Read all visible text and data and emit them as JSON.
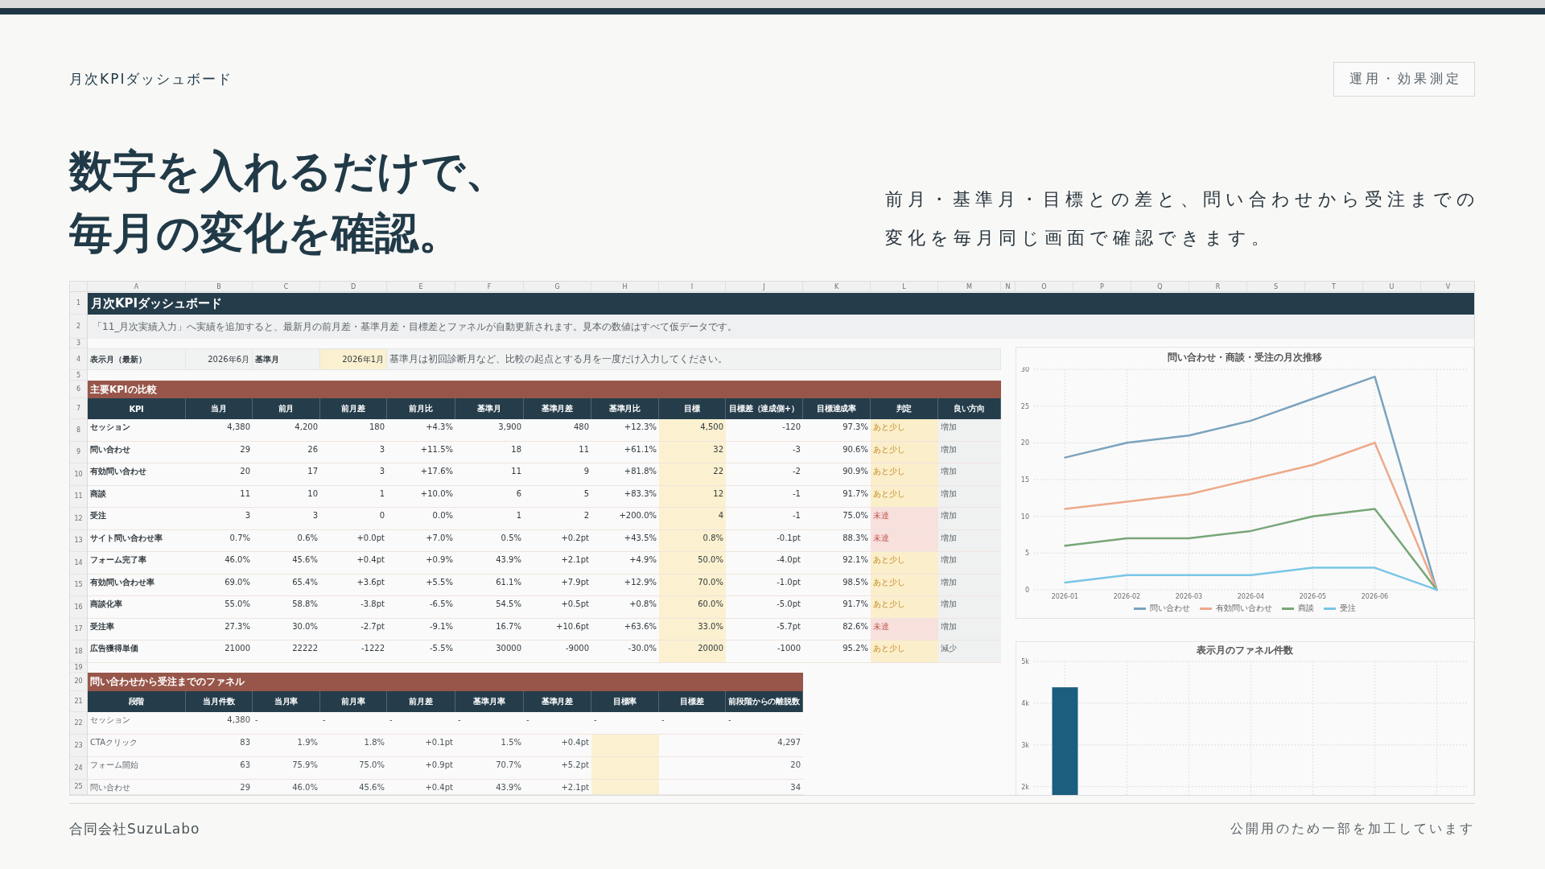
{
  "top": {
    "page_label": "月次KPIダッシュボード",
    "tag": "運用・効果測定"
  },
  "headline": [
    "数字を入れるだけで、",
    "毎月の変化を確認。"
  ],
  "description": [
    "前月・基準月・目標との差と、問い合わせから受注までの",
    "変化を毎月同じ画面で確認できます。"
  ],
  "spreadsheet": {
    "column_letters": [
      "A",
      "B",
      "C",
      "D",
      "E",
      "F",
      "G",
      "H",
      "I",
      "J",
      "K",
      "L",
      "M",
      "N",
      "O",
      "P",
      "Q",
      "R",
      "S",
      "T",
      "U",
      "V"
    ],
    "row_numbers": [
      "1",
      "2",
      "3",
      "4",
      "5",
      "6",
      "7",
      "8",
      "9",
      "10",
      "11",
      "12",
      "13",
      "14",
      "15",
      "16",
      "17",
      "18",
      "19",
      "20",
      "21",
      "22",
      "23",
      "24",
      "25"
    ],
    "title": "月次KPIダッシュボード",
    "note": "「11_月次実績入力」へ実績を追加すると、最新月の前月差・基準月差・目標差とファネルが自動更新されます。見本の数値はすべて仮データです。",
    "month_settings": {
      "fields": [
        {
          "label": "表示月（最新）",
          "value": "2026年6月",
          "input": false
        },
        {
          "label": "基準月",
          "value": "2026年1月",
          "input": true
        }
      ],
      "hint": "基準月は初回診断月など、比較の起点とする月を一度だけ入力してください。"
    },
    "kpi": {
      "title": "主要KPIの比較",
      "columns": [
        {
          "label": "KPI",
          "input": false
        },
        {
          "label": "当月",
          "input": false
        },
        {
          "label": "前月",
          "input": false
        },
        {
          "label": "前月差",
          "input": false
        },
        {
          "label": "前月比",
          "input": false
        },
        {
          "label": "基準月",
          "input": false
        },
        {
          "label": "基準月差",
          "input": false
        },
        {
          "label": "基準月比",
          "input": false
        },
        {
          "label": "目標",
          "input": true
        },
        {
          "label": "目標差（達成側+）",
          "input": false
        },
        {
          "label": "目標達成率",
          "input": false
        },
        {
          "label": "判定",
          "input": false
        },
        {
          "label": "良い方向",
          "input": false
        }
      ],
      "rows": [
        {
          "kpi": "セッション",
          "values": [
            "4,380",
            "4,200",
            "180",
            "+4.3%",
            "3,900",
            "480",
            "+12.3%",
            "4,500",
            "-120",
            "97.3%"
          ],
          "verdict": {
            "text": "あと少し",
            "kind": "near"
          },
          "direction": "増加"
        },
        {
          "kpi": "問い合わせ",
          "values": [
            "29",
            "26",
            "3",
            "+11.5%",
            "18",
            "11",
            "+61.1%",
            "32",
            "-3",
            "90.6%"
          ],
          "verdict": {
            "text": "あと少し",
            "kind": "near"
          },
          "direction": "増加"
        },
        {
          "kpi": "有効問い合わせ",
          "values": [
            "20",
            "17",
            "3",
            "+17.6%",
            "11",
            "9",
            "+81.8%",
            "22",
            "-2",
            "90.9%"
          ],
          "verdict": {
            "text": "あと少し",
            "kind": "near"
          },
          "direction": "増加"
        },
        {
          "kpi": "商談",
          "values": [
            "11",
            "10",
            "1",
            "+10.0%",
            "6",
            "5",
            "+83.3%",
            "12",
            "-1",
            "91.7%"
          ],
          "verdict": {
            "text": "あと少し",
            "kind": "near"
          },
          "direction": "増加"
        },
        {
          "kpi": "受注",
          "values": [
            "3",
            "3",
            "0",
            "0.0%",
            "1",
            "2",
            "+200.0%",
            "4",
            "-1",
            "75.0%"
          ],
          "verdict": {
            "text": "未達",
            "kind": "below"
          },
          "direction": "増加"
        },
        {
          "kpi": "サイト問い合わせ率",
          "values": [
            "0.7%",
            "0.6%",
            "+0.0pt",
            "+7.0%",
            "0.5%",
            "+0.2pt",
            "+43.5%",
            "0.8%",
            "-0.1pt",
            "88.3%"
          ],
          "verdict": {
            "text": "未達",
            "kind": "below"
          },
          "direction": "増加"
        },
        {
          "kpi": "フォーム完了率",
          "values": [
            "46.0%",
            "45.6%",
            "+0.4pt",
            "+0.9%",
            "43.9%",
            "+2.1pt",
            "+4.9%",
            "50.0%",
            "-4.0pt",
            "92.1%"
          ],
          "verdict": {
            "text": "あと少し",
            "kind": "near"
          },
          "direction": "増加"
        },
        {
          "kpi": "有効問い合わせ率",
          "values": [
            "69.0%",
            "65.4%",
            "+3.6pt",
            "+5.5%",
            "61.1%",
            "+7.9pt",
            "+12.9%",
            "70.0%",
            "-1.0pt",
            "98.5%"
          ],
          "verdict": {
            "text": "あと少し",
            "kind": "near"
          },
          "direction": "増加"
        },
        {
          "kpi": "商談化率",
          "values": [
            "55.0%",
            "58.8%",
            "-3.8pt",
            "-6.5%",
            "54.5%",
            "+0.5pt",
            "+0.8%",
            "60.0%",
            "-5.0pt",
            "91.7%"
          ],
          "verdict": {
            "text": "あと少し",
            "kind": "near"
          },
          "direction": "増加"
        },
        {
          "kpi": "受注率",
          "values": [
            "27.3%",
            "30.0%",
            "-2.7pt",
            "-9.1%",
            "16.7%",
            "+10.6pt",
            "+63.6%",
            "33.0%",
            "-5.7pt",
            "82.6%"
          ],
          "verdict": {
            "text": "未達",
            "kind": "below"
          },
          "direction": "増加"
        },
        {
          "kpi": "広告獲得単価",
          "values": [
            "21000",
            "22222",
            "-1222",
            "-5.5%",
            "30000",
            "-9000",
            "-30.0%",
            "20000",
            "-1000",
            "95.2%"
          ],
          "verdict": {
            "text": "あと少し",
            "kind": "near"
          },
          "direction": "減少"
        }
      ]
    },
    "funnel": {
      "title": "問い合わせから受注までのファネル",
      "columns": [
        "段階",
        "当月件数",
        "当月率",
        "前月率",
        "前月差",
        "基準月率",
        "基準月差",
        "目標率",
        "目標差",
        "前段階からの離脱数"
      ],
      "rows": [
        {
          "stage": "セッション",
          "kind": "base",
          "count": "4,380",
          "rates": [
            "-",
            "-",
            "-",
            "-",
            "-"
          ],
          "target_rate": "-",
          "target_diff": "-",
          "dropoff": "-"
        },
        {
          "stage": "CTAクリック",
          "kind": "step",
          "count": "83",
          "rates": [
            "1.9%",
            "1.8%",
            "+0.1pt",
            "1.5%",
            "+0.4pt"
          ],
          "dropoff": "4,297"
        },
        {
          "stage": "フォーム開始",
          "kind": "step",
          "count": "63",
          "rates": [
            "75.9%",
            "75.0%",
            "+0.9pt",
            "70.7%",
            "+5.2pt"
          ],
          "dropoff": "20"
        },
        {
          "stage": "問い合わせ",
          "kind": "step",
          "count": "29",
          "rates": [
            "46.0%",
            "45.6%",
            "+0.4pt",
            "43.9%",
            "+2.1pt"
          ],
          "dropoff": "34"
        }
      ]
    },
    "charts": [
      {
        "chart_data": {
          "type": "line",
          "title": "問い合わせ・商談・受注の月次推移",
          "categories": [
            "2026-01",
            "2026-02",
            "2026-03",
            "2026-04",
            "2026-05",
            "2026-06",
            null
          ],
          "ylim": [
            0,
            30
          ],
          "yticks": [
            {
              "value": 0,
              "label": "0"
            },
            {
              "value": 5,
              "label": "5"
            },
            {
              "value": 10,
              "label": "10"
            },
            {
              "value": 15,
              "label": "15"
            },
            {
              "value": 20,
              "label": "20"
            },
            {
              "value": 25,
              "label": "25"
            },
            {
              "value": 30,
              "label": "30"
            }
          ],
          "grid": true,
          "legend": "bottom",
          "series": [
            {
              "name": "問い合わせ",
              "color": "#7ba3be",
              "values": [
                18,
                20,
                21,
                23,
                26,
                29,
                0
              ]
            },
            {
              "name": "有効問い合わせ",
              "color": "#eda98a",
              "values": [
                11,
                12,
                13,
                15,
                17,
                20,
                0
              ]
            },
            {
              "name": "商談",
              "color": "#78a678",
              "values": [
                6,
                7,
                7,
                8,
                10,
                11,
                0
              ]
            },
            {
              "name": "受注",
              "color": "#79c6e6",
              "values": [
                1,
                2,
                2,
                2,
                3,
                3,
                0
              ]
            }
          ]
        }
      },
      {
        "chart_data": {
          "type": "bar",
          "title": "表示月のファネル件数",
          "categories": [
            null,
            null,
            null,
            null,
            null,
            null,
            null
          ],
          "values": [
            4380,
            null,
            null,
            null,
            null,
            null,
            null
          ],
          "ylim": [
            1800,
            5000
          ],
          "yticks": [
            {
              "value": 2000,
              "label": "2k"
            },
            {
              "value": 3000,
              "label": "3k"
            },
            {
              "value": 4000,
              "label": "4k"
            },
            {
              "value": 5000,
              "label": "5k"
            }
          ],
          "grid": true
        }
      }
    ]
  },
  "footer": {
    "company": "合同会社SuzuLabo",
    "note": "公開用のため一部を加工しています"
  }
}
